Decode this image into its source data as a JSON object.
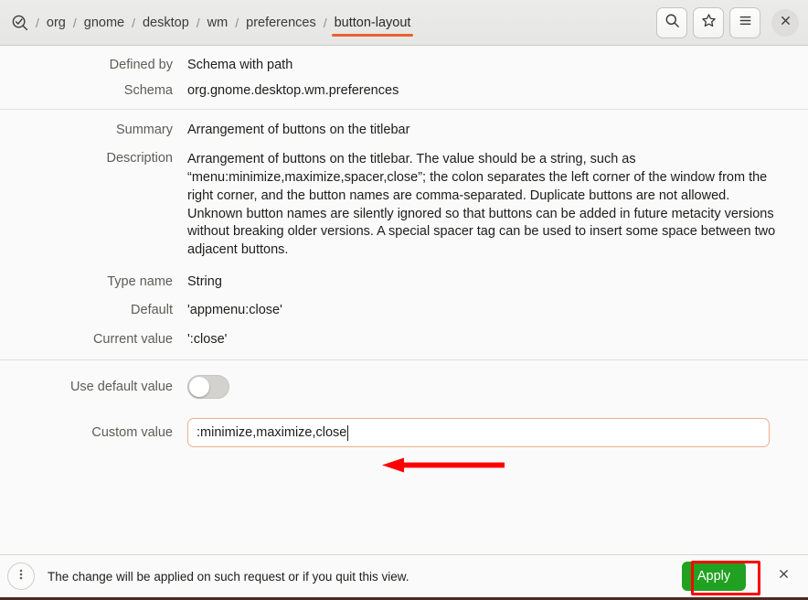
{
  "header": {
    "app_icon": "search-check-icon",
    "breadcrumb": [
      {
        "label": "org",
        "active": false
      },
      {
        "label": "gnome",
        "active": false
      },
      {
        "label": "desktop",
        "active": false
      },
      {
        "label": "wm",
        "active": false
      },
      {
        "label": "preferences",
        "active": false
      },
      {
        "label": "button-layout",
        "active": true
      }
    ],
    "separator": "/",
    "buttons": [
      {
        "name": "search-icon",
        "label": "Search"
      },
      {
        "name": "star-icon",
        "label": "Bookmark"
      },
      {
        "name": "hamburger-menu-icon",
        "label": "Menu"
      }
    ],
    "close_label": "×",
    "accent_color": "#e8622c"
  },
  "details": {
    "defined_by_label": "Defined by",
    "defined_by_value": "Schema with path",
    "schema_label": "Schema",
    "schema_value": "org.gnome.desktop.wm.preferences",
    "summary_label": "Summary",
    "summary_value": "Arrangement of buttons on the titlebar",
    "description_label": "Description",
    "description_value": "Arrangement of buttons on the titlebar. The value should be a string, such as “menu:minimize,maximize,spacer,close”; the colon separates the left corner of the window from the right corner, and the button names are comma-separated. Duplicate buttons are not allowed. Unknown button names are silently ignored so that buttons can be added in future metacity versions without breaking older versions. A special spacer tag can be used to insert some space between two adjacent buttons.",
    "type_name_label": "Type name",
    "type_name_value": "String",
    "default_label": "Default",
    "default_value": "'appmenu:close'",
    "current_value_label": "Current value",
    "current_value_value": "':close'"
  },
  "editor": {
    "use_default_label": "Use default value",
    "use_default_state": "off",
    "custom_value_label": "Custom value",
    "custom_value_text": ":minimize,maximize,close",
    "custom_value_placeholder": ""
  },
  "bottombar": {
    "menu_icon": "vertical-dots-icon",
    "message": "The change will be applied on such request or if you quit this view.",
    "apply_label": "Apply",
    "apply_color": "#21a121",
    "close_label": "×"
  },
  "annotations": {
    "arrow_color": "#ff0000",
    "highlight_color": "#ff0000"
  }
}
